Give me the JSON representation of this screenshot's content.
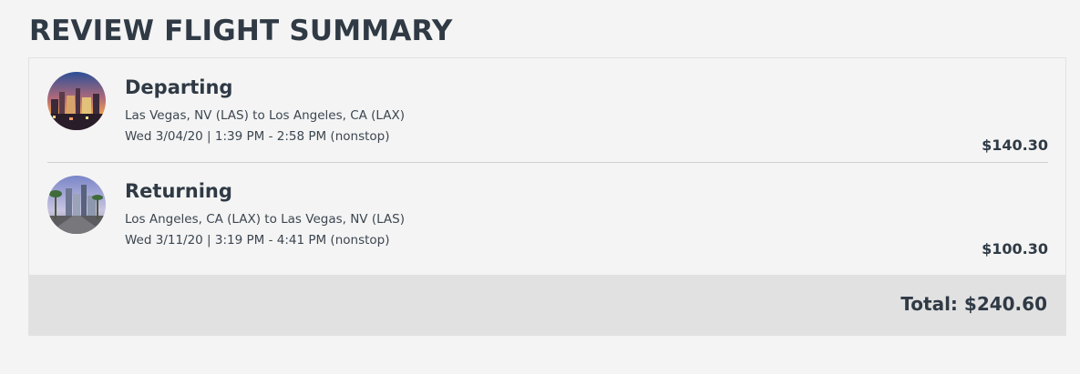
{
  "page": {
    "title": "REVIEW FLIGHT SUMMARY"
  },
  "flights": [
    {
      "label": "Departing",
      "route": "Las Vegas, NV (LAS) to Los Angeles, CA (LAX)",
      "schedule": "Wed 3/04/20 | 1:39 PM - 2:58 PM (nonstop)",
      "price": "$140.30",
      "image": "las-vegas-skyline-photo"
    },
    {
      "label": "Returning",
      "route": "Los Angeles, CA (LAX) to Las Vegas, NV (LAS)",
      "schedule": "Wed 3/11/20 | 3:19 PM - 4:41 PM (nonstop)",
      "price": "$100.30",
      "image": "los-angeles-city-photo"
    }
  ],
  "summary": {
    "total_text": "Total: $240.60"
  },
  "colors": {
    "text": "#2f3a45",
    "background": "#f4f4f4",
    "total_bar": "#e1e1e1",
    "divider": "#cfcfcf"
  }
}
